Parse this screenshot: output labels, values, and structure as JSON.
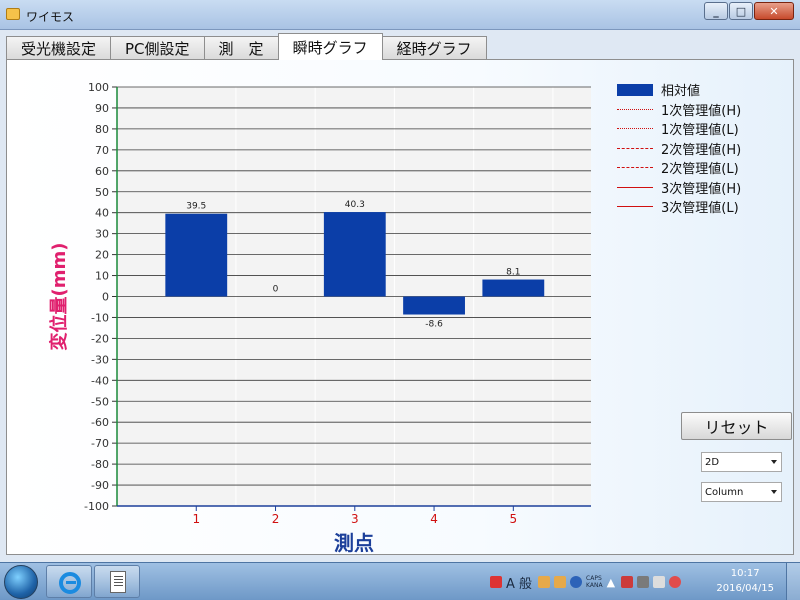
{
  "window": {
    "title": "ワイモス"
  },
  "tabs": [
    {
      "label": "受光機設定",
      "active": false
    },
    {
      "label": "PC側設定",
      "active": false
    },
    {
      "label": "測　定",
      "active": false
    },
    {
      "label": "瞬時グラフ",
      "active": true
    },
    {
      "label": "経時グラフ",
      "active": false
    }
  ],
  "chart_data": {
    "type": "bar",
    "categories": [
      "1",
      "2",
      "3",
      "4",
      "5"
    ],
    "series": [
      {
        "name": "相対値",
        "values": [
          39.5,
          0,
          40.3,
          -8.6,
          8.1
        ]
      }
    ],
    "data_labels": [
      "39.5",
      "0",
      "40.3",
      "-8.6",
      "8.1"
    ],
    "ylabel": "変位量(mm)",
    "xlabel": "測点",
    "ylim": [
      -100,
      100
    ],
    "yticks": [
      100,
      90,
      80,
      70,
      60,
      50,
      40,
      30,
      20,
      10,
      0,
      -10,
      -20,
      -30,
      -40,
      -50,
      -60,
      -70,
      -80,
      -90,
      -100
    ],
    "grid": true,
    "legend_position": "right",
    "legend": [
      {
        "label": "相対値",
        "style": "bar",
        "color": "#0b3ea8"
      },
      {
        "label": "1次管理値(H)",
        "style": "dotted",
        "color": "#d01010"
      },
      {
        "label": "1次管理値(L)",
        "style": "dotted",
        "color": "#d01010"
      },
      {
        "label": "2次管理値(H)",
        "style": "dashed",
        "color": "#d01010"
      },
      {
        "label": "2次管理値(L)",
        "style": "dashed",
        "color": "#d01010"
      },
      {
        "label": "3次管理値(H)",
        "style": "solid",
        "color": "#d01010"
      },
      {
        "label": "3次管理値(L)",
        "style": "solid",
        "color": "#d01010"
      }
    ],
    "colors": {
      "bar": "#0b3ea8",
      "ylabel": "#e0206e",
      "xlabel": "#1c3f9a",
      "x_ticks": "#d01010"
    }
  },
  "controls": {
    "reset_label": "リセット",
    "view_select": "2D",
    "type_select": "Column"
  },
  "taskbar": {
    "time": "10:17",
    "date": "2016/04/15",
    "ime_label": "A 般",
    "caps": "CAPS",
    "kana": "KANA"
  }
}
